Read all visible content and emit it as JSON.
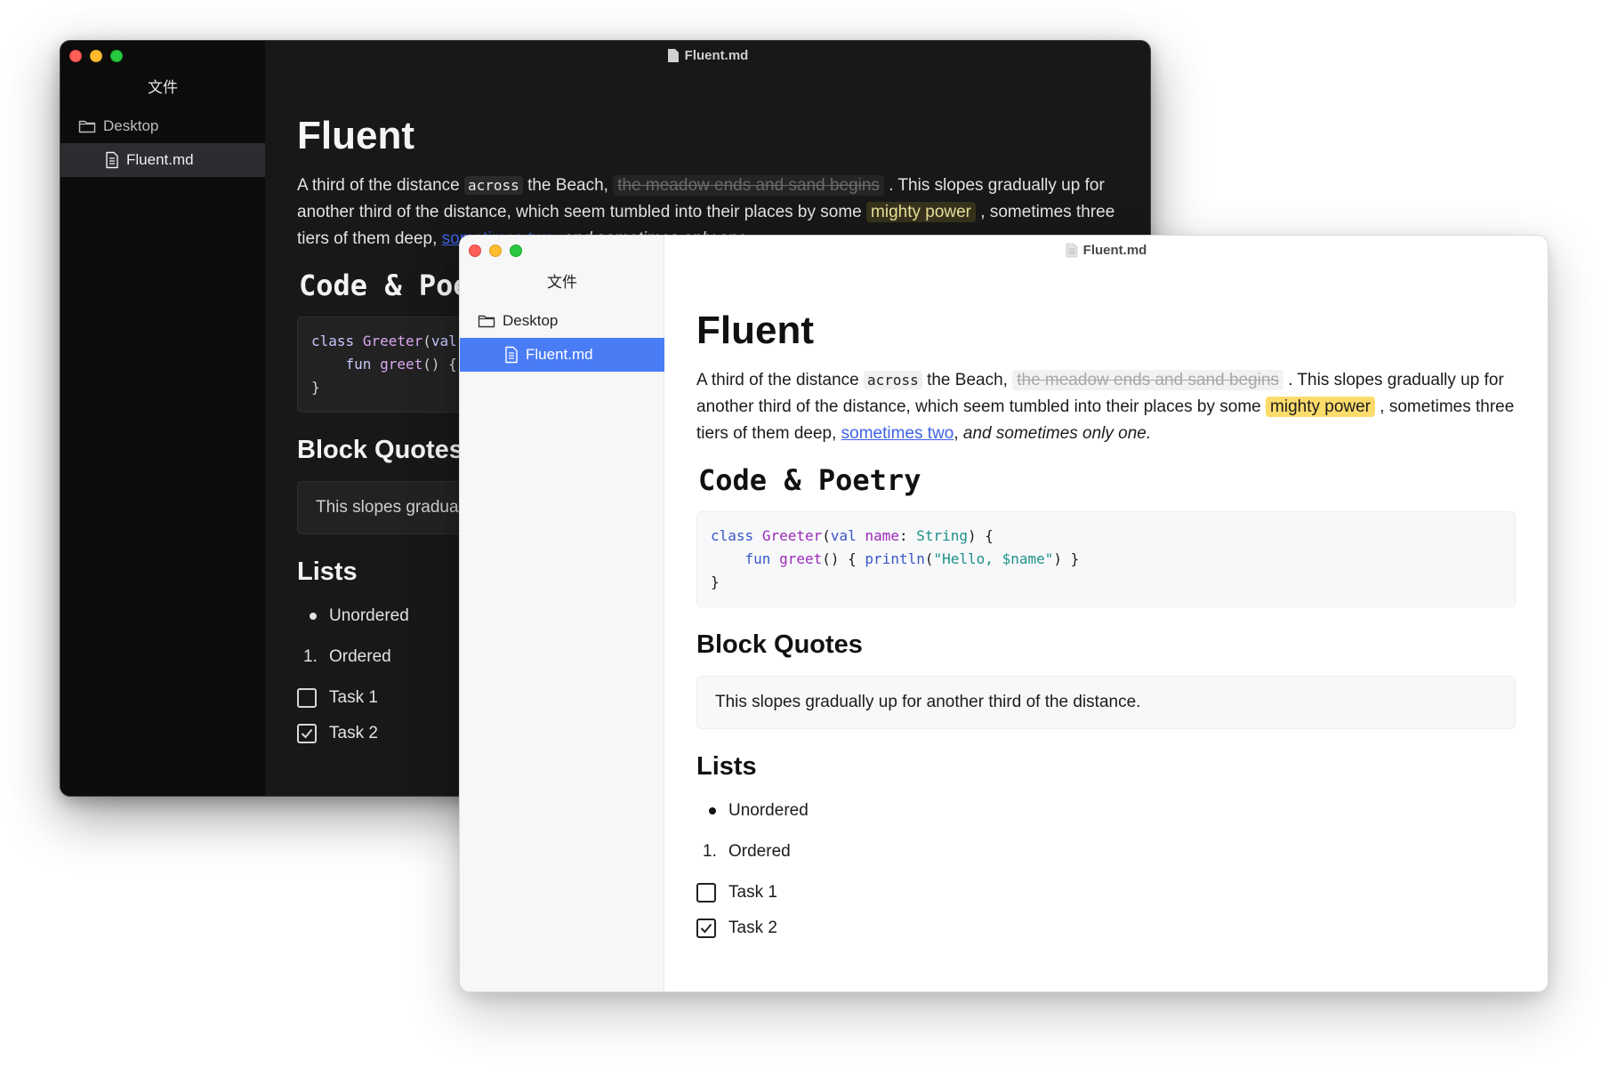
{
  "sidebar": {
    "title": "文件",
    "folder_label": "Desktop",
    "file_label": "Fluent.md"
  },
  "window": {
    "title": "Fluent.md"
  },
  "doc": {
    "h1": "Fluent",
    "p1": {
      "t1": "A third of the distance ",
      "code": "across",
      "t2": " the Beach, ",
      "strike": "the meadow ends and sand begins",
      "t3": " . This slopes gradually up for another third of the distance, which seem tumbled into their places by some ",
      "mark": "mighty power",
      "t4": " , sometimes three tiers of them deep, ",
      "link": "sometimes two",
      "t5": ", ",
      "em": "and sometimes only one."
    },
    "h2_code": "Code & Poetry",
    "code_lines": {
      "l1_kw": "class",
      "l1_cls": "Greeter",
      "l1_p1": "(",
      "l1_kw2": "val",
      "l1_name": "name",
      "l1_p2": ": ",
      "l1_type": "String",
      "l1_p3": ") {",
      "l2_kw": "fun",
      "l2_fn": "greet",
      "l2_p1": "() { ",
      "l2_fn2": "println",
      "l2_p2": "(",
      "l2_str": "\"Hello, $name\"",
      "l2_p3": ") }",
      "l3": "}"
    },
    "h2_quote": "Block Quotes",
    "quote": "This slopes gradually up for another third of the distance.",
    "h2_lists": "Lists",
    "list": {
      "unordered": "Unordered",
      "ordered_num": "1.",
      "ordered": "Ordered",
      "task1": "Task 1",
      "task1_checked": false,
      "task2": "Task 2",
      "task2_checked": true
    }
  },
  "icons": {
    "folder": "folder-icon",
    "file": "document-icon",
    "check": "checkmark-icon"
  },
  "colors": {
    "accent": "#4a7cf6",
    "highlight": "#fbdc6b",
    "link": "#3d63e6"
  }
}
